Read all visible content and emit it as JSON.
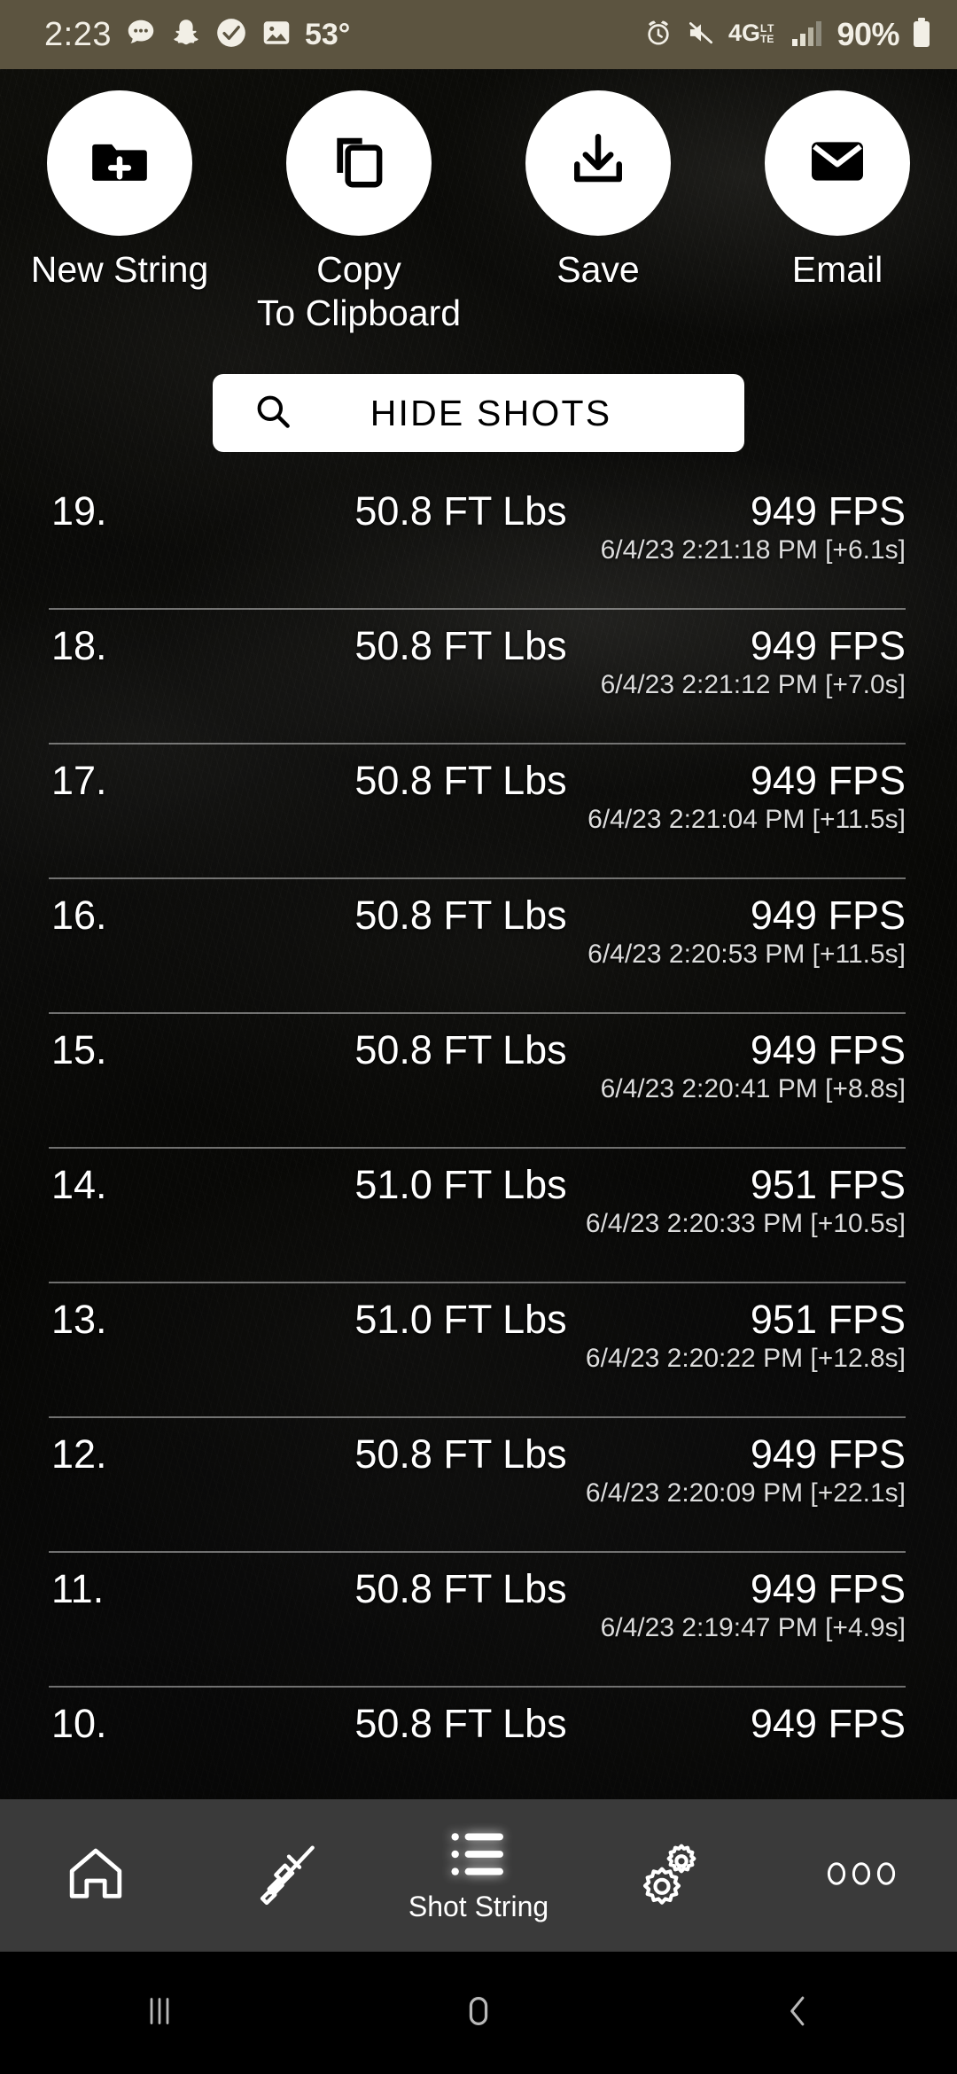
{
  "status_bar": {
    "time": "2:23",
    "temperature": "53°",
    "network": "4G",
    "network_sub": "LTE",
    "battery": "90%",
    "icons": [
      "chat-bubble-icon",
      "snapchat-ghost-icon",
      "check-circle-icon",
      "image-icon",
      "alarm-icon",
      "mute-icon",
      "signal-bars-icon",
      "battery-icon"
    ],
    "bg_color": "#5c5440"
  },
  "actions": [
    {
      "label": "New String",
      "icon": "folder-plus-icon"
    },
    {
      "label": "Copy\nTo Clipboard",
      "icon": "copy-icon"
    },
    {
      "label": "Save",
      "icon": "download-icon"
    },
    {
      "label": "Email",
      "icon": "envelope-icon"
    }
  ],
  "hide_shots": {
    "label": "HIDE SHOTS",
    "icon": "search-icon"
  },
  "shot_list": {
    "columns": [
      "number",
      "energy",
      "velocity",
      "timestamp"
    ],
    "rows": [
      {
        "number": "19.",
        "energy": "50.8 FT Lbs",
        "velocity": "949 FPS",
        "timestamp": "6/4/23 2:21:18 PM [+6.1s]"
      },
      {
        "number": "18.",
        "energy": "50.8 FT Lbs",
        "velocity": "949 FPS",
        "timestamp": "6/4/23 2:21:12 PM [+7.0s]"
      },
      {
        "number": "17.",
        "energy": "50.8 FT Lbs",
        "velocity": "949 FPS",
        "timestamp": "6/4/23 2:21:04 PM [+11.5s]"
      },
      {
        "number": "16.",
        "energy": "50.8 FT Lbs",
        "velocity": "949 FPS",
        "timestamp": "6/4/23 2:20:53 PM [+11.5s]"
      },
      {
        "number": "15.",
        "energy": "50.8 FT Lbs",
        "velocity": "949 FPS",
        "timestamp": "6/4/23 2:20:41 PM [+8.8s]"
      },
      {
        "number": "14.",
        "energy": "51.0 FT Lbs",
        "velocity": "951 FPS",
        "timestamp": "6/4/23 2:20:33 PM [+10.5s]"
      },
      {
        "number": "13.",
        "energy": "51.0 FT Lbs",
        "velocity": "951 FPS",
        "timestamp": "6/4/23 2:20:22 PM [+12.8s]"
      },
      {
        "number": "12.",
        "energy": "50.8 FT Lbs",
        "velocity": "949 FPS",
        "timestamp": "6/4/23 2:20:09 PM [+22.1s]"
      },
      {
        "number": "11.",
        "energy": "50.8 FT Lbs",
        "velocity": "949 FPS",
        "timestamp": "6/4/23 2:19:47 PM [+4.9s]"
      },
      {
        "number": "10.",
        "energy": "50.8 FT Lbs",
        "velocity": "949 FPS",
        "timestamp": ""
      }
    ]
  },
  "bottom_nav": {
    "items": [
      {
        "label": "",
        "icon": "home-icon",
        "active": false
      },
      {
        "label": "",
        "icon": "rifle-icon",
        "active": false
      },
      {
        "label": "Shot String",
        "icon": "list-icon",
        "active": true
      },
      {
        "label": "",
        "icon": "gears-icon",
        "active": false
      },
      {
        "label": "",
        "icon": "more-dots-icon",
        "active": false
      }
    ],
    "bg_color": "#3a3a3a"
  },
  "system_nav": {
    "items": [
      "recents-icon",
      "home-circle-icon",
      "back-icon"
    ],
    "bg_color": "#000000"
  }
}
